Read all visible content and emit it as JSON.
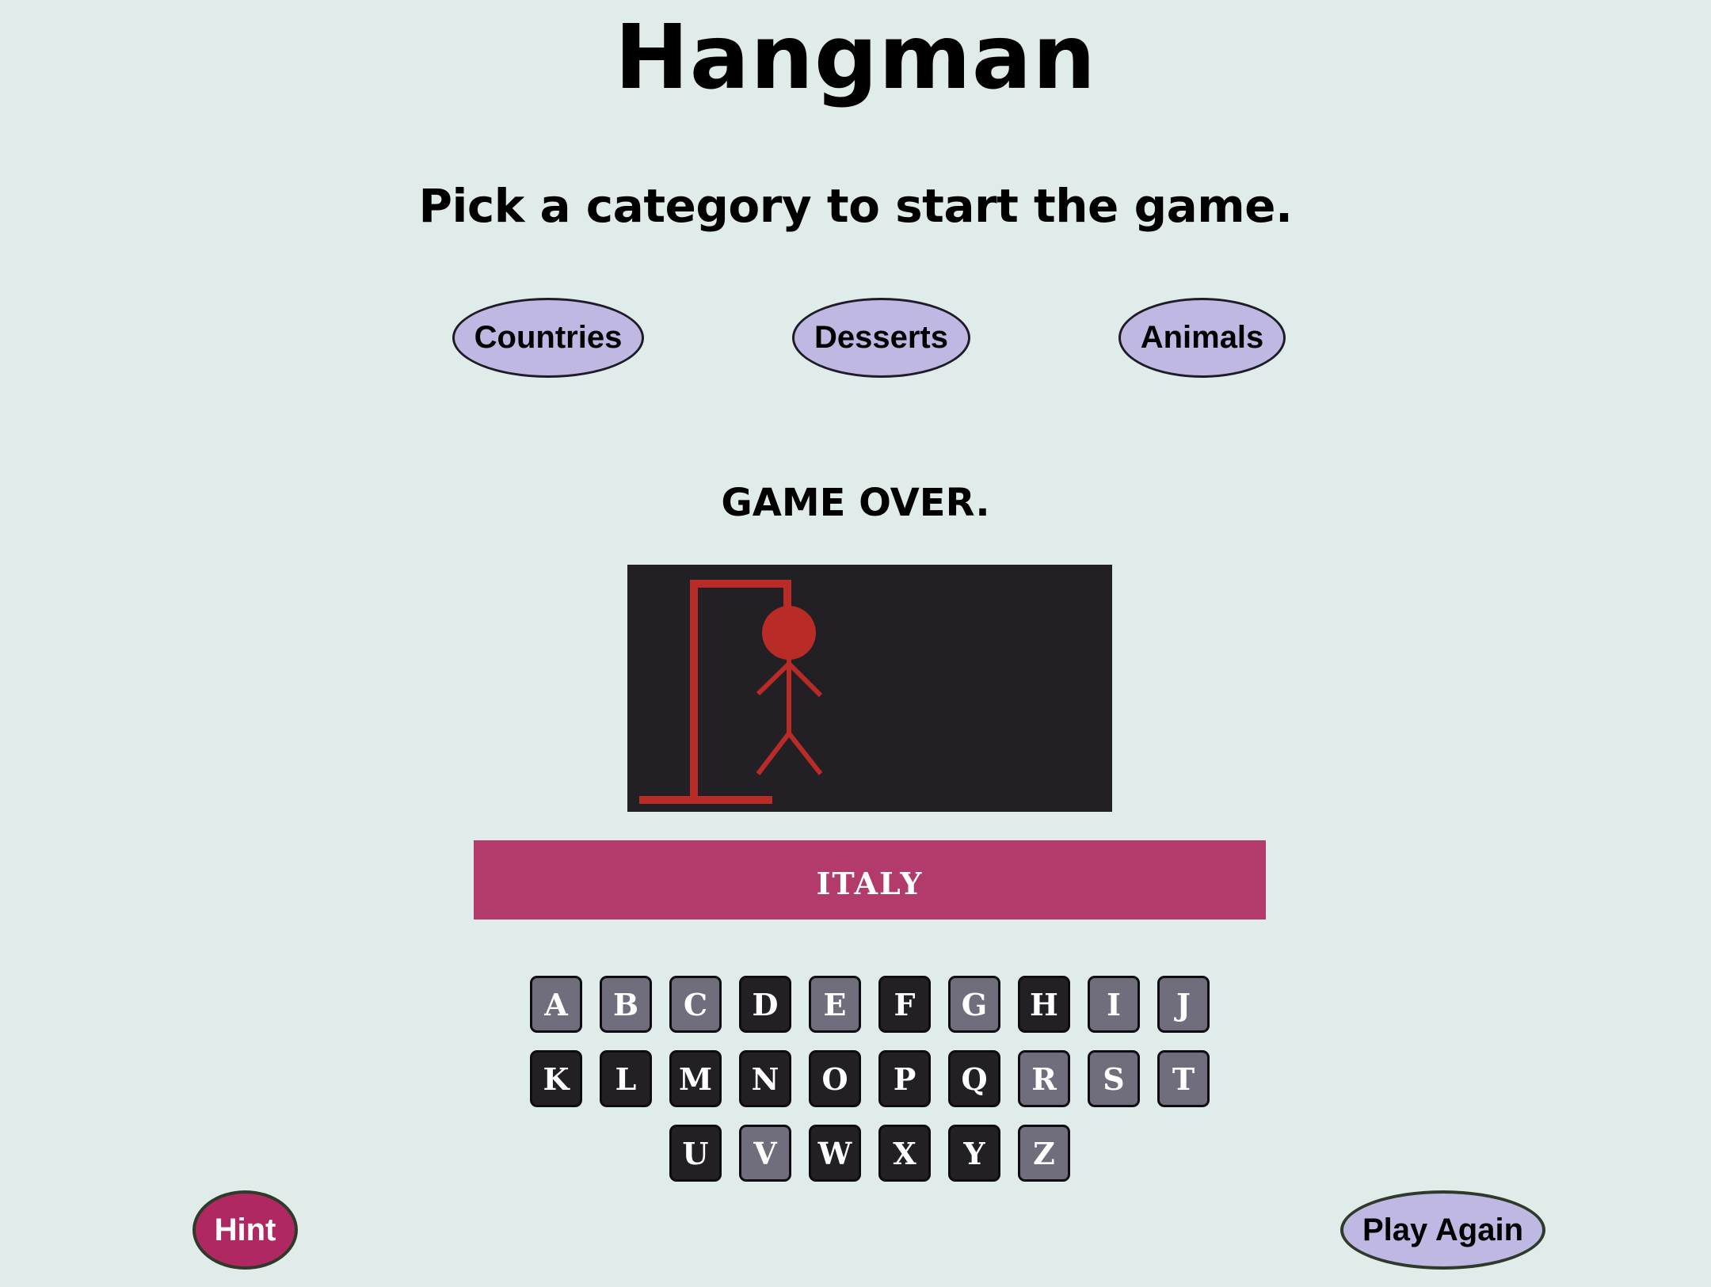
{
  "title": "Hangman",
  "subtitle": "Pick a category to start the game.",
  "categories": [
    "Countries",
    "Desserts",
    "Animals"
  ],
  "status": "GAME OVER.",
  "word": "ITALY",
  "hangman_color": "#b92b27",
  "keyboard": {
    "rows": [
      [
        "A",
        "B",
        "C",
        "D",
        "E",
        "F",
        "G",
        "H",
        "I",
        "J"
      ],
      [
        "K",
        "L",
        "M",
        "N",
        "O",
        "P",
        "Q",
        "R",
        "S",
        "T"
      ],
      [
        "U",
        "V",
        "W",
        "X",
        "Y",
        "Z"
      ]
    ],
    "used_letters": [
      "A",
      "B",
      "C",
      "E",
      "G",
      "I",
      "J",
      "R",
      "S",
      "T",
      "V",
      "Z"
    ]
  },
  "hint_label": "Hint",
  "play_again_label": "Play Again"
}
